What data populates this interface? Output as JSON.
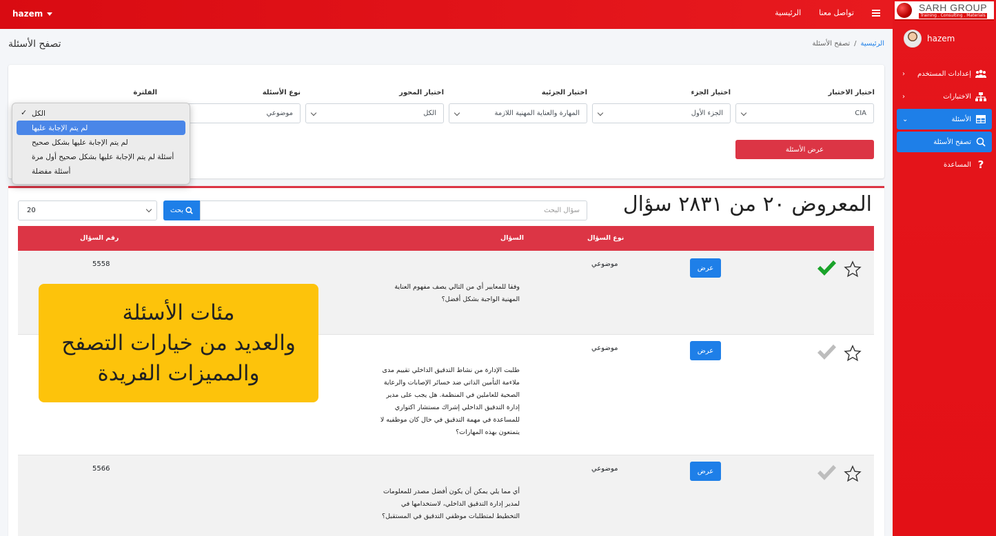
{
  "navbar": {
    "user": "hazem",
    "links": [
      "الرئيسية",
      "تواصل معنا"
    ]
  },
  "sidebar": {
    "brand_title": "SARH GROUP",
    "brand_subtitle": "Training . Consulting . Materials",
    "user": "hazem",
    "items": [
      {
        "label": "إعدادات المستخدم",
        "icon": "users-icon",
        "chevron": "‹"
      },
      {
        "label": "الاختبارات",
        "icon": "sitemap-icon",
        "chevron": "‹"
      },
      {
        "label": "الأسئلة",
        "icon": "table-icon",
        "chevron": "⌄"
      },
      {
        "label": "تصفح الأسئلة",
        "icon": "search-icon",
        "chevron": ""
      },
      {
        "label": "المساعدة",
        "icon": "question-icon",
        "chevron": ""
      }
    ]
  },
  "header": {
    "title": "تصفح الأسئلة",
    "breadcrumb_home": "الرئيسية",
    "breadcrumb_sep": "/",
    "breadcrumb_current": "تصفح الأسئلة"
  },
  "filters": {
    "exam_label": "اختيار الاختبار",
    "exam_value": "CIA",
    "part_label": "اختيار الجزء",
    "part_value": "الجزء الأول",
    "subpart_label": "اختيار الجزئية",
    "subpart_value": "المهارة والعناية المهنية اللازمة",
    "axis_label": "اختيار المحور",
    "axis_value": "الكل",
    "type_label": "نوع الأسئلة",
    "type_value": "موضوعي",
    "filter_label": "الفلترة",
    "show_button": "عرض الأسئلة"
  },
  "dropdown": {
    "options": [
      "الكل",
      "لم يتم الإجابة عليها",
      "لم يتم الإجابة عليها بشكل صحيح",
      "أسئلة لم يتم الإجابة عليها بشكل صحيح أول مرة",
      "أسئلة مفضلة"
    ],
    "checked_index": 0,
    "highlighted_index": 1
  },
  "results": {
    "heading": "المعروض ٢٠ من ٢٨٣١ سؤال",
    "search_placeholder": "سؤال البحث",
    "search_button": "بحث",
    "per_page": "20",
    "columns": {
      "number": "رقم السؤال",
      "question": "السؤال",
      "type": "نوع السؤال"
    },
    "rows": [
      {
        "number": "5558",
        "question": "وفقا للمعايير أي من التالي يصف مفهوم العناية المهنية الواجبة بشكل أفضل؟",
        "type": "موضوعي",
        "view": "عرض",
        "answered_correct": true
      },
      {
        "number": "",
        "question": "طلبت الإدارة من نشاط التدقيق الداخلي تقييم مدى ملاءمة التأمين الذاتي ضد خسائر الإصابات والرعاية الصحية للعاملين في المنظمة. هل يجب على مدير إدارة التدقيق الداخلي إشراك مستشار اكتواري للمساعدة في مهمة التدقيق في حال كان موظفيه لا يتمتعون بهذه المهارات؟",
        "type": "موضوعي",
        "view": "عرض",
        "answered_correct": false
      },
      {
        "number": "5566",
        "question": "أي مما يلي يمكن أن يكون أفضل مصدر للمعلومات لمدير إدارة التدقيق الداخلي، لاستخدامها في التخطيط لمتطلبات موظفي التدقيق في المستقبل؟",
        "type": "موضوعي",
        "view": "عرض",
        "answered_correct": false
      }
    ]
  },
  "promo": {
    "line1": "مئات الأسئلة",
    "line2": "والعديد من خيارات التصفح",
    "line3": "والمميزات الفريدة"
  },
  "colors": {
    "primary_red": "#dc3545",
    "nav_red": "#e31016",
    "blue": "#1e7fe8",
    "promo": "#fdc30b",
    "check_green": "#1aa32a",
    "check_gray": "#bdbdbd"
  }
}
